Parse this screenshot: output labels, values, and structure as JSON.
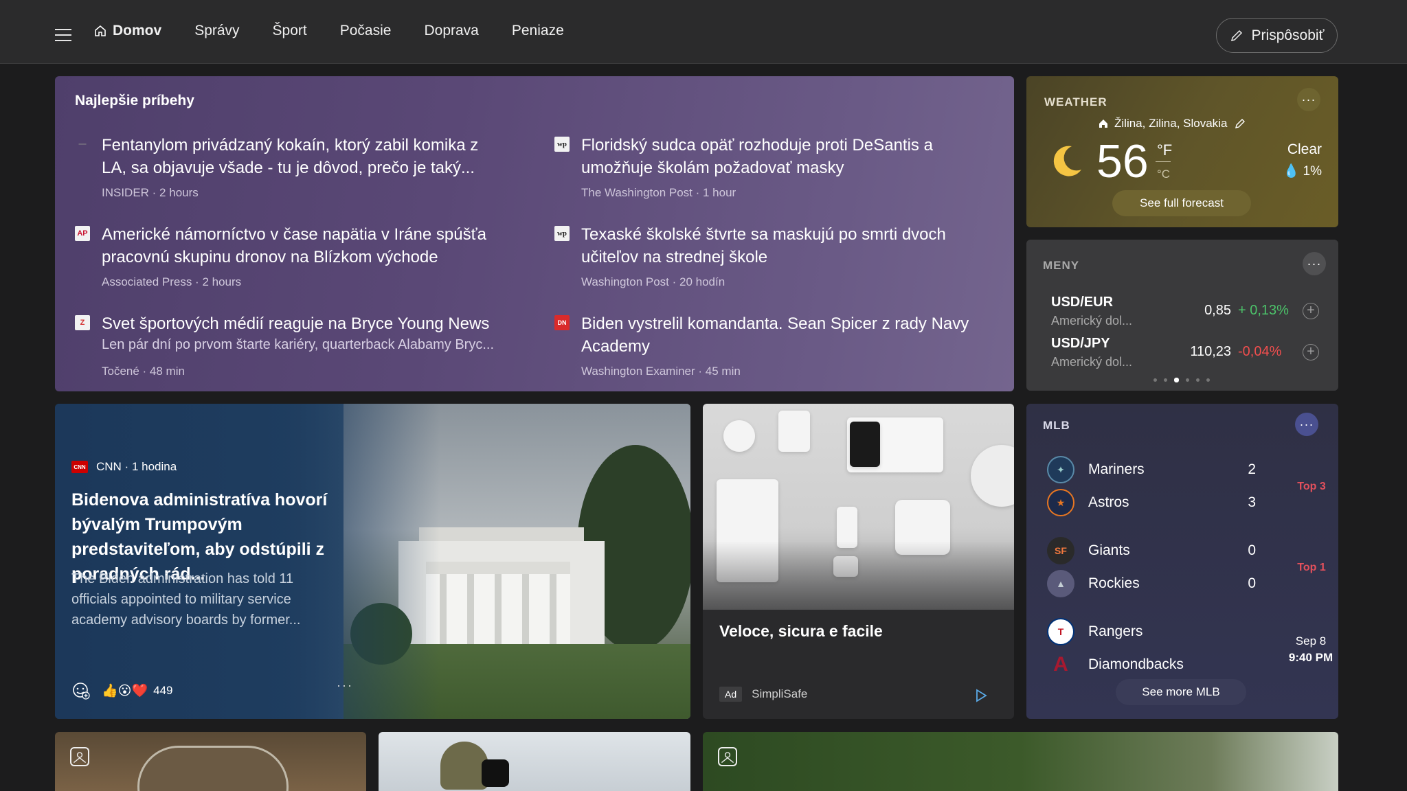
{
  "nav": {
    "home": "Domov",
    "items": [
      "Správy",
      "Šport",
      "Počasie",
      "Doprava",
      "Peniaze"
    ],
    "customize": "Prispôsobiť"
  },
  "top_stories": {
    "title": "Najlepšie príbehy",
    "items": [
      {
        "headline": "Fentanylom privádzaný kokaín, ktorý zabil komika z LA, sa objavuje všade - tu je dôvod, prečo je taký...",
        "meta": "INSIDER · 2 hours",
        "logo": "—"
      },
      {
        "headline": "Floridský sudca opäť rozhoduje proti DeSantis a umožňuje školám požadovať masky",
        "meta": "The Washington Post · 1 hour",
        "logo": "wp"
      },
      {
        "headline": "Americké námorníctvo v čase napätia v Iráne spúšťa pracovnú skupinu dronov na Blízkom východe",
        "meta": "Associated Press · 2 hours",
        "logo": "AP"
      },
      {
        "headline": "Texaské školské štvrte sa maskujú po smrti dvoch učiteľov na strednej škole",
        "meta": "Washington Post · 20 hodín",
        "logo": "wp"
      },
      {
        "headline": "Svet športových médií reaguje na Bryce Young News",
        "snippet": "Len pár dní po prvom štarte kariéry, quarterback Alabamy Bryc...",
        "meta": "Točené · 48 min",
        "logo": "Z"
      },
      {
        "headline": "Biden vystrelil komandanta. Sean Spicer z rady Navy Academy",
        "meta": "Washington Examiner · 45 min",
        "logo": "DN"
      }
    ]
  },
  "weather": {
    "label": "WEATHER",
    "location": "Žilina, Zilina, Slovakia",
    "temp": "56",
    "unit_f": "°F",
    "unit_c": "°C",
    "condition": "Clear",
    "precip": "1%",
    "forecast_btn": "See full forecast"
  },
  "currency": {
    "label": "MENY",
    "rows": [
      {
        "pair": "USD/EUR",
        "name": "Americký dol...",
        "value": "0,85",
        "change": "+ 0,13%",
        "color": "#4cc36a"
      },
      {
        "pair": "USD/JPY",
        "name": "Americký dol...",
        "value": "110,23",
        "change": "-0,04%",
        "color": "#f04e4e"
      }
    ]
  },
  "mlb": {
    "label": "MLB",
    "games": [
      {
        "team1": "Mariners",
        "score1": "2",
        "team2": "Astros",
        "score2": "3",
        "status": "Top 3"
      },
      {
        "team1": "Giants",
        "score1": "0",
        "team2": "Rockies",
        "score2": "0",
        "status": "Top 1"
      },
      {
        "team1": "Rangers",
        "team2": "Diamondbacks",
        "date": "Sep 8",
        "time": "9:40 PM"
      }
    ],
    "more_btn": "See more MLB"
  },
  "hero": {
    "source": "CNN · 1 hodina",
    "title": "Bidenova administratíva hovorí bývalým Trumpovým predstaviteľom, aby odstúpili z poradných rád...",
    "description": "The Biden administration has told 11 officials appointed to military service academy advisory boards by former...",
    "reactions": "449"
  },
  "ad": {
    "title": "Veloce, sicura e facile",
    "badge": "Ad",
    "advertiser": "SimpliSafe"
  },
  "colors": {
    "accent_green": "#4cc36a",
    "accent_red": "#f04e4e",
    "mlb_status": "#e2505c"
  }
}
